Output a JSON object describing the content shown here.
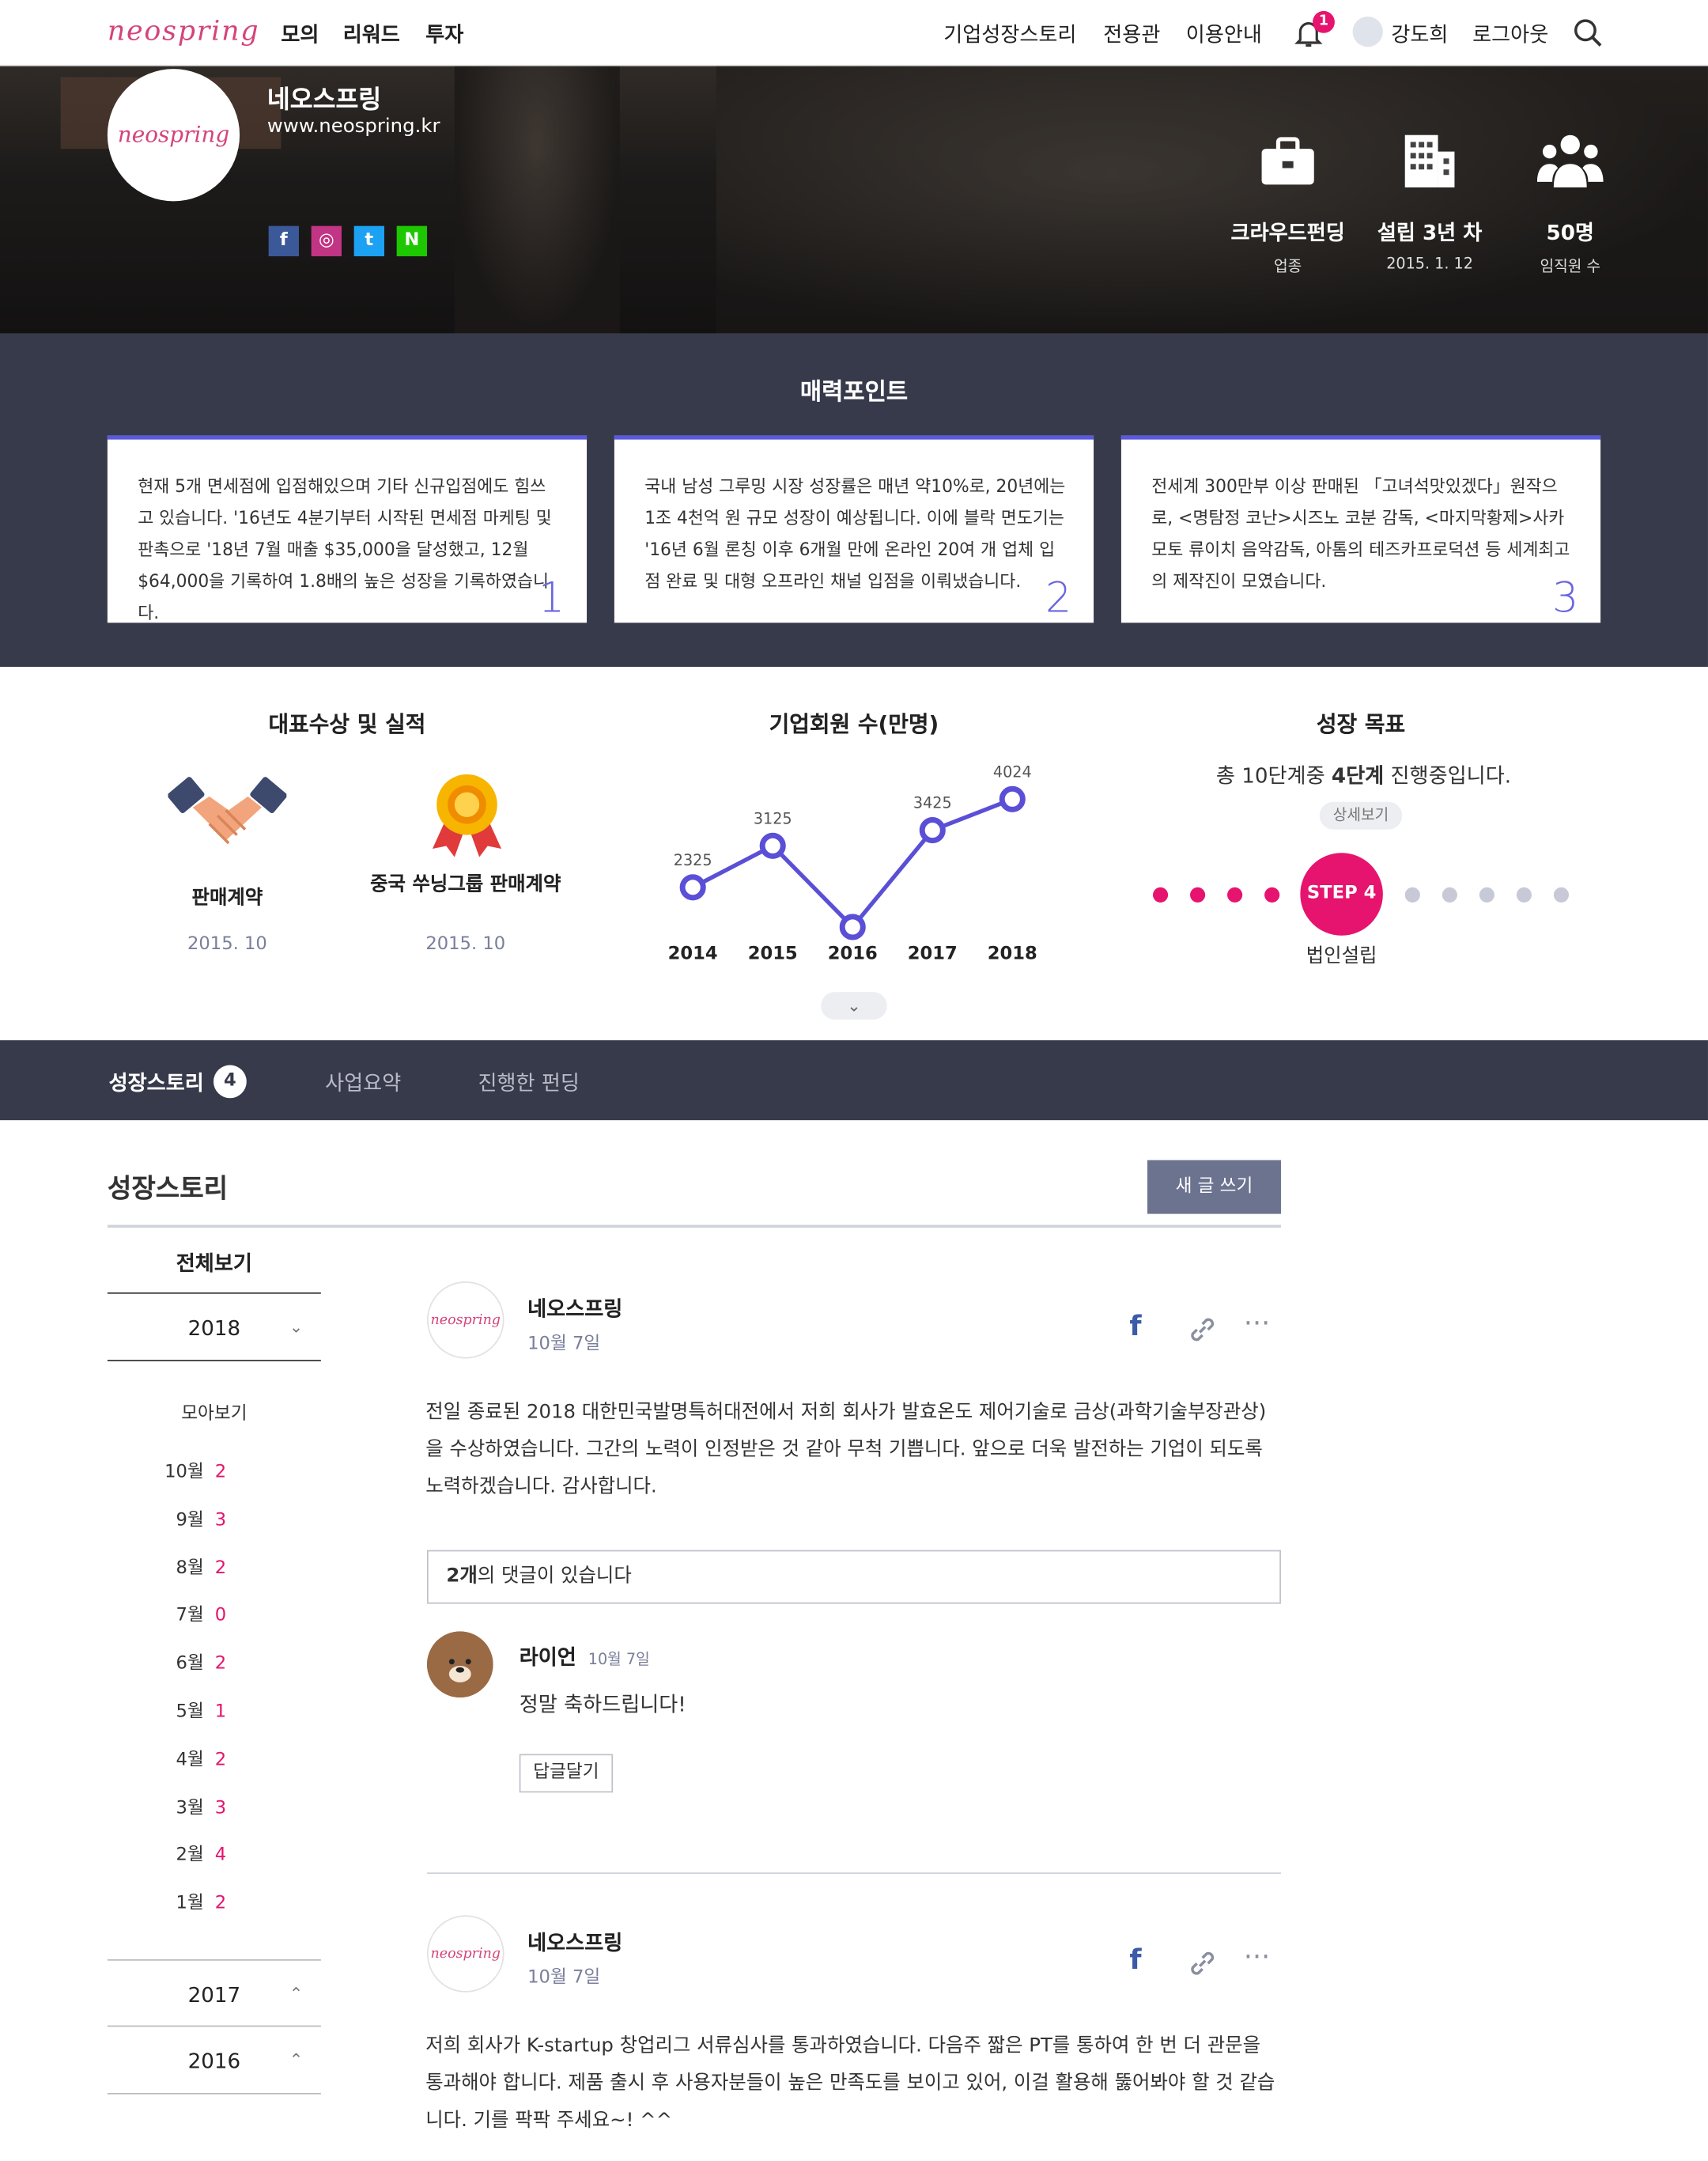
{
  "nav": {
    "logo": "neospring",
    "menu": [
      "모의",
      "리워드",
      "투자"
    ],
    "right": [
      "기업성장스토리",
      "전용관",
      "이용안내"
    ],
    "notif_count": "1",
    "user": "강도희",
    "logout": "로그아웃"
  },
  "hero": {
    "logo": "neospring",
    "name": "네오스프링",
    "url": "www.neospring.kr",
    "sns": [
      "f",
      "◎",
      "t",
      "N"
    ],
    "stats": [
      {
        "title": "크라우드펀딩",
        "sub": "업종",
        "icon": "briefcase-icon"
      },
      {
        "title": "설립 3년 차",
        "sub": "2015. 1. 12",
        "icon": "building-icon"
      },
      {
        "title": "50명",
        "sub": "임직원 수",
        "icon": "people-icon"
      }
    ]
  },
  "points": {
    "title": "매력포인트",
    "cards": [
      {
        "text": "현재 5개 면세점에 입점해있으며 기타 신규입점에도 힘쓰고 있습니다. '16년도 4분기부터 시작된 면세점 마케팅 및 판촉으로 '18년 7월 매출 $35,000을 달성했고, 12월 $64,000을 기록하여 1.8배의 높은 성장을 기록하였습니다.",
        "n": "1"
      },
      {
        "text": "국내 남성 그루밍 시장 성장률은 매년 약10%로, 20년에는 1조 4천억 원 규모 성장이 예상됩니다. 이에 블락 면도기는 '16년 6월 론칭 이후 6개월 만에 온라인 20여 개 업체 입점 완료 및 대형 오프라인 채널 입점을 이뤄냈습니다.",
        "n": "2"
      },
      {
        "text": "전세계 300만부 이상 판매된 「고녀석맛있겠다」원작으로, <명탐정 코난>시즈노 코분 감독, <마지막황제>사카모토 류이치 음악감독, 아톰의 테즈카프로덕션 등 세계최고의 제작진이 모였습니다.",
        "n": "3"
      }
    ]
  },
  "awards": {
    "title": "대표수상 및 실적",
    "items": [
      {
        "label": "판매계약",
        "date": "2015. 10"
      },
      {
        "label": "중국 쑤닝그룹 판매계약",
        "date": "2015. 10"
      }
    ]
  },
  "members": {
    "title": "기업회원 수(만명)"
  },
  "chart_data": {
    "type": "line",
    "title": "기업회원 수(만명)",
    "categories": [
      "2014",
      "2015",
      "2016",
      "2017",
      "2018"
    ],
    "series": [
      {
        "values": [
          2325,
          3125,
          null,
          3425,
          4024
        ]
      }
    ],
    "data_labels": [
      "2325",
      "3125",
      "",
      "3425",
      "4024"
    ]
  },
  "goal": {
    "title": "성장 목표",
    "text_pre": "총 10단계중 ",
    "text_bold": "4단계",
    "text_post": " 진행중입니다.",
    "detail": "상세보기",
    "step": "STEP 4",
    "step_label": "법인설립",
    "done": 4,
    "total": 10
  },
  "tabs": {
    "items": [
      "성장스토리",
      "사업요약",
      "진행한 펀딩"
    ],
    "badge": "4"
  },
  "story": {
    "title": "성장스토리",
    "write": "새 글 쓰기",
    "all": "전체보기",
    "years": [
      "2018",
      "2017",
      "2016"
    ],
    "archive": "모아보기",
    "months": [
      {
        "m": "10월",
        "c": "2"
      },
      {
        "m": "9월",
        "c": "3"
      },
      {
        "m": "8월",
        "c": "2"
      },
      {
        "m": "7월",
        "c": "0"
      },
      {
        "m": "6월",
        "c": "2"
      },
      {
        "m": "5월",
        "c": "1"
      },
      {
        "m": "4월",
        "c": "2"
      },
      {
        "m": "3월",
        "c": "3"
      },
      {
        "m": "2월",
        "c": "4"
      },
      {
        "m": "1월",
        "c": "2"
      }
    ]
  },
  "posts": [
    {
      "author": "네오스프링",
      "date": "10월 7일",
      "avatar": "neospring",
      "body": "전일 종료된 2018 대한민국발명특허대전에서 저희 회사가 발효온도 제어기술로 금상(과학기술부장관상)을 수상하였습니다. 그간의 노력이 인정받은 것 같아 무척 기쁩니다. 앞으로 더욱 발전하는 기업이 되도록 노력하겠습니다. 감사합니다.",
      "comments_count": "2개",
      "comments_suffix": "의 댓글이 있습니다",
      "comment": {
        "author": "라이언",
        "date": "10월 7일",
        "text": "정말 축하드립니다!",
        "reply": "답글달기"
      }
    },
    {
      "author": "네오스프링",
      "date": "10월 7일",
      "avatar": "neospring",
      "body": "저희 회사가 K-startup 창업리그 서류심사를 통과하였습니다. 다음주 짧은 PT를 통하여 한 번 더 관문을 통과해야 합니다. 제품 출시 후 사용자분들이 높은 만족도를 보이고 있어, 이걸 활용해 뚫어봐야 할 것 같습니다. 기를 팍팍 주세요~! ^^"
    }
  ],
  "colors": {
    "accent": "#e6146e",
    "dark": "#373a4b",
    "purple": "#5a4fd6"
  }
}
